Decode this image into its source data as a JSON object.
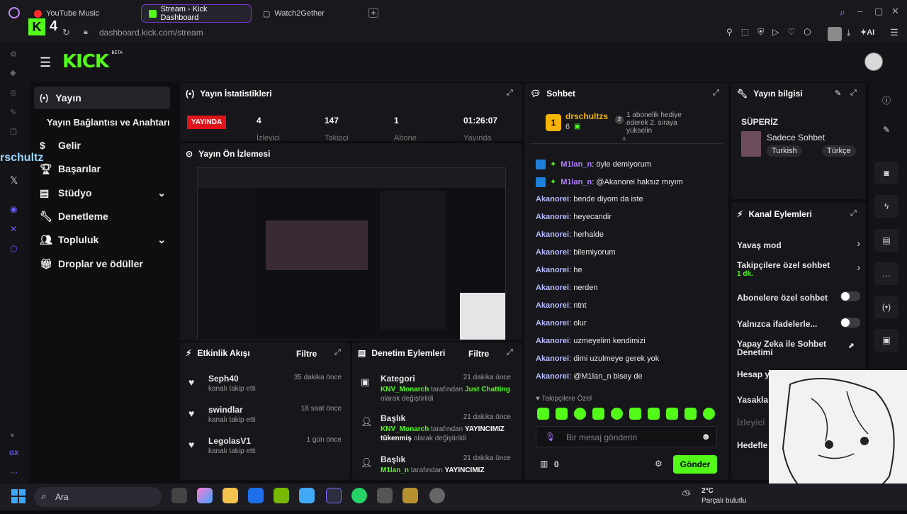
{
  "browser": {
    "tabs": [
      {
        "label": "YouTube Music"
      },
      {
        "label": "Stream - Kick Dashboard"
      },
      {
        "label": "Watch2Gether"
      }
    ],
    "url": "dashboard.kick.com/stream",
    "badge_count": "4",
    "ai_label": "AI"
  },
  "overlay": {
    "floating_name": "rschultz"
  },
  "kick": {
    "logo": "KICK",
    "logo_badge": "BETA"
  },
  "nav": {
    "items": [
      {
        "label": "Yayın"
      },
      {
        "label": "Yayın Bağlantısı ve Anahtarı"
      },
      {
        "label": "Gelir"
      },
      {
        "label": "Başarılar"
      },
      {
        "label": "Stüdyo"
      },
      {
        "label": "Denetleme"
      },
      {
        "label": "Topluluk"
      },
      {
        "label": "Droplar ve ödüller"
      }
    ]
  },
  "stats": {
    "title": "Yayın İstatistikleri",
    "live_badge": "YAYINDA",
    "items": [
      {
        "value": "4",
        "label": "İzleyici"
      },
      {
        "value": "147",
        "label": "Takipçi"
      },
      {
        "value": "1",
        "label": "Abone"
      },
      {
        "value": "01:26:07",
        "label": "Yayında"
      }
    ]
  },
  "preview": {
    "title": "Yayın Ön İzlemesi"
  },
  "activity": {
    "title": "Etkinlik Akışı",
    "filter": "Filtre",
    "events": [
      {
        "name": "Seph40",
        "desc": "kanalı takip etti",
        "time": "35 dakika önce"
      },
      {
        "name": "swindlar",
        "desc": "kanalı takip etti",
        "time": "18 saat önce"
      },
      {
        "name": "LegolasV1",
        "desc": "kanalı takip etti",
        "time": "1 gün önce"
      }
    ]
  },
  "modlog": {
    "title": "Denetim Eylemleri",
    "filter": "Filtre",
    "items": [
      {
        "type": "Kategori",
        "time": "21 dakika önce",
        "actor": "KNV_Monarch",
        "mid": " tarafından ",
        "obj": "Just Chatting",
        "end": " olarak değiştirildi"
      },
      {
        "type": "Başlık",
        "time": "21 dakika önce",
        "actor": "KNV_Monarch",
        "mid": " tarafından ",
        "obj": "YAYINCIMIZ tükenmiş",
        "end": " olarak değiştirildi"
      },
      {
        "type": "Başlık",
        "time": "21 dakika önce",
        "actor": "M1lan_n",
        "mid": " tarafından ",
        "obj": "YAYINCIMIZ",
        "end": ""
      }
    ]
  },
  "chat": {
    "title": "Sohbet",
    "pinned_user": "drschultzs",
    "pinned_count": "6",
    "pinned_rank": "1",
    "pinned_text": "1 abonelik hediye ederek 2. sıraya yükselin",
    "pinned_rank2": "2",
    "messages": [
      {
        "user": "M1lan_n",
        "text": "öyle demiyorum",
        "badges": true
      },
      {
        "user": "M1lan_n",
        "text": "@Akanorei haksız mıyım",
        "badges": true
      },
      {
        "user": "Akanorei",
        "text": "bende diyom da iste"
      },
      {
        "user": "Akanorei",
        "text": "heyecandir"
      },
      {
        "user": "Akanorei",
        "text": "herhalde"
      },
      {
        "user": "Akanorei",
        "text": "bilemiyorum"
      },
      {
        "user": "Akanorei",
        "text": "he"
      },
      {
        "user": "Akanorei",
        "text": "nerden"
      },
      {
        "user": "Akanorei",
        "text": "ntnt"
      },
      {
        "user": "Akanorei",
        "text": "olur"
      },
      {
        "user": "Akanorei",
        "text": "uzmeyelim kendimizi"
      },
      {
        "user": "Akanorei",
        "text": "dimi uzulmeye gerek yok"
      },
      {
        "user": "Akanorei",
        "text": "@M1lan_n bisey de"
      }
    ],
    "followers_only": "Takipçilere Özel",
    "input_placeholder": "Bir mesaj gönderin",
    "points": "0",
    "send": "Gönder"
  },
  "info": {
    "title": "Yayın bilgisi",
    "stream_title": "SÜPERİZ",
    "category": "Sadece Sohbet",
    "tags": [
      "Turkish",
      "Türkçe"
    ]
  },
  "actions": {
    "title": "Kanal Eylemleri",
    "items": [
      {
        "label": "Yavaş mod",
        "kind": "chevron"
      },
      {
        "label": "Takipçilere özel sohbet",
        "sub": "1 dk.",
        "kind": "chevron"
      },
      {
        "label": "Abonelere özel sohbet",
        "kind": "toggle"
      },
      {
        "label": "Yalnızca ifadelerle...",
        "kind": "toggle"
      },
      {
        "label": "Yapay Zeka ile Sohbet Denetimi",
        "kind": "link"
      },
      {
        "label": "Hesap y",
        "kind": "none"
      },
      {
        "label": "Yasakla",
        "kind": "none"
      },
      {
        "label": "İzleyici",
        "kind": "none"
      },
      {
        "label": "Hedefle",
        "kind": "none"
      }
    ]
  },
  "taskbar": {
    "search": "Ara",
    "temp": "2°C",
    "weather": "Parçalı bulutlu"
  }
}
